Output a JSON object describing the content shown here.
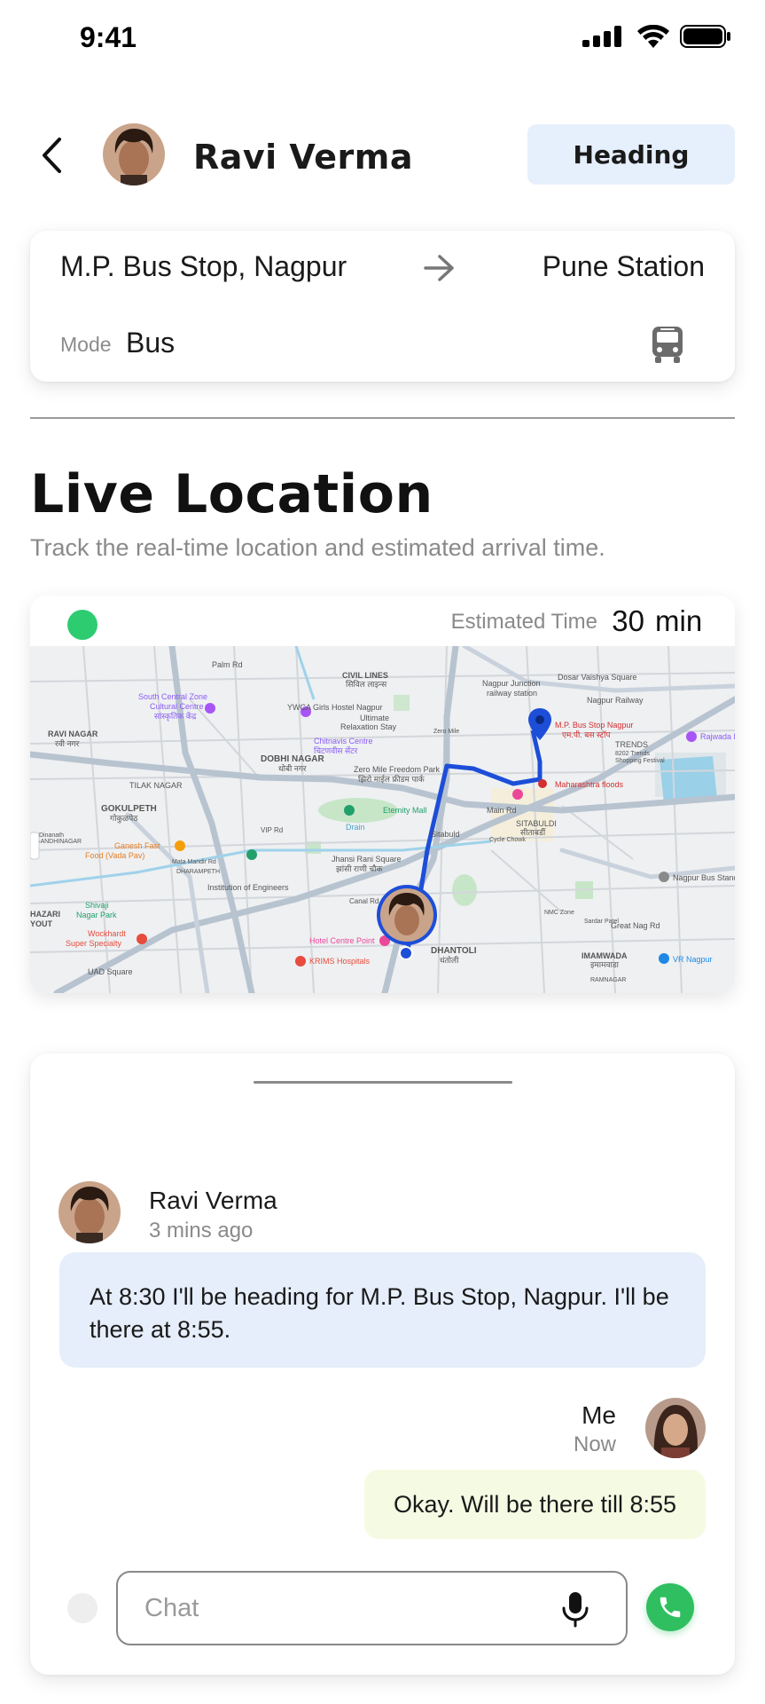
{
  "status_bar": {
    "time": "9:41"
  },
  "header": {
    "contact_name": "Ravi Verma",
    "action_label": "Heading"
  },
  "route": {
    "from": "M.P. Bus Stop, Nagpur",
    "to": "Pune Station",
    "mode_label": "Mode",
    "mode_value": "Bus"
  },
  "live_location": {
    "title": "Live Location",
    "subtitle": "Track the real-time location and estimated arrival time."
  },
  "map": {
    "eta_label": "Estimated Time",
    "eta_value": "30",
    "eta_unit": "min",
    "labels": {
      "ravi_nagar": "RAVI NAGAR",
      "ravi_nagar_local": "रवी नगर",
      "south_central": "South Central Zone",
      "south_central_2": "Cultural Centre",
      "south_central_local": "सांस्कृतिक केंद्र",
      "palm_rd": "Palm Rd",
      "civil_lines": "CIVIL LINES",
      "civil_lines_local": "सिविल लाइन्स",
      "ywca": "YWCA Girls Hostel Nagpur",
      "ywca_2": "Ultimate",
      "ywca_3": "Relaxation Stay",
      "chitnavis": "Chitnavis Centre",
      "chitnavis_local": "चिटणवीस सेंटर",
      "dobhi_nagar": "DOBHI NAGAR",
      "dobhi_nagar_local": "धोबी नगर",
      "zero_mile": "Zero Mile Freedom Park",
      "zero_mile_local": "झिरो माईल फ्रीडम पार्क",
      "zero_mile_short": "Zero Mile",
      "nagpur_junction": "Nagpur Junction",
      "nagpur_junction_2": "railway station",
      "dosar": "Dosar Vaishya Square",
      "nagpur_railway": "Nagpur Railway",
      "mp_bus_stop": "M.P. Bus Stop Nagpur",
      "mp_bus_stop_local": "एम.पी. बस स्टॉप",
      "trends": "TRENDS",
      "trends_2": "8202 Trends",
      "trends_3": "Shopping Festival",
      "rajwada": "Rajwada P",
      "maharashtra_floods": "Maharashtra floods",
      "gokulpeth": "GOKULPETH",
      "gokulpeth_local": "गोकुळपेठ",
      "tilak_nagar": "TILAK NAGAR",
      "ganesh_fast": "Ganesh Fast",
      "ganesh_fast_2": "Food (Vada Pav)",
      "eternity_mall": "Eternity Mall",
      "drain": "Drain",
      "main_rd": "Main Rd",
      "sitabuldi": "SITABULDI",
      "sitabuldi_local": "सीताबर्डी",
      "sitabuld": "Sitabuld",
      "cycle_chowk": "Cycle Chowk",
      "jhansi_rani": "Jhansi Rani Square",
      "jhansi_rani_local": "झांसी राणी चौक",
      "institution": "Institution of Engineers",
      "dharampeth": "DHARAMPETH",
      "nagpur_bus_stand": "Nagpur Bus Stand",
      "hotel_centre_point": "Hotel Centre Point",
      "dhantoli": "DHANTOLI",
      "dhantoli_local": "धंतोली",
      "krims": "KRIMS Hospitals",
      "wockhardt": "Wockhardt",
      "wockhardt_2": "Super Specialty",
      "shivaji_nagar": "Shivaji",
      "shivaji_nagar_2": "Nagar Park",
      "imamwada": "IMAMWADA",
      "imamwada_local": "इमामवाडा",
      "vr_nagpur": "VR Nagpur",
      "ramnagar": "RAMNAGAR",
      "hazari": "HAZARI",
      "hazari_2": "YOUT",
      "mata_mandir": "Mata Mandir Rd",
      "great_nag_rd": "Great Nag Rd",
      "vip_rd": "VIP Rd",
      "canal_rd": "Canal Rd",
      "dinanath": "Dinanath",
      "nmc_zone": "NMC Zone",
      "sardar_patel": "Sardar Patel",
      "uad_square": "UAD Square",
      "gandhinagar": "GANDHINAGAR"
    }
  },
  "chat": {
    "messages": [
      {
        "sender": "Ravi Verma",
        "time": "3 mins ago",
        "text": "At 8:30 I'll be heading for M.P. Bus Stop, Nagpur. I'll be there at 8:55."
      },
      {
        "sender": "Me",
        "time": "Now",
        "text": "Okay. Will be there till 8:55"
      }
    ],
    "input_placeholder": "Chat"
  },
  "colors": {
    "accent_bg": "#e6effc",
    "online": "#2ecc71",
    "route_line": "#1d4ed8",
    "call": "#2fbf60",
    "my_bubble": "#f5fbe3",
    "their_bubble": "#e6eefb"
  },
  "icons": {
    "back": "chevron-left-icon",
    "arrow": "arrow-right-icon",
    "bus": "bus-icon",
    "mic": "microphone-icon",
    "call": "phone-icon",
    "signal": "signal-icon",
    "wifi": "wifi-icon",
    "battery": "battery-icon"
  }
}
